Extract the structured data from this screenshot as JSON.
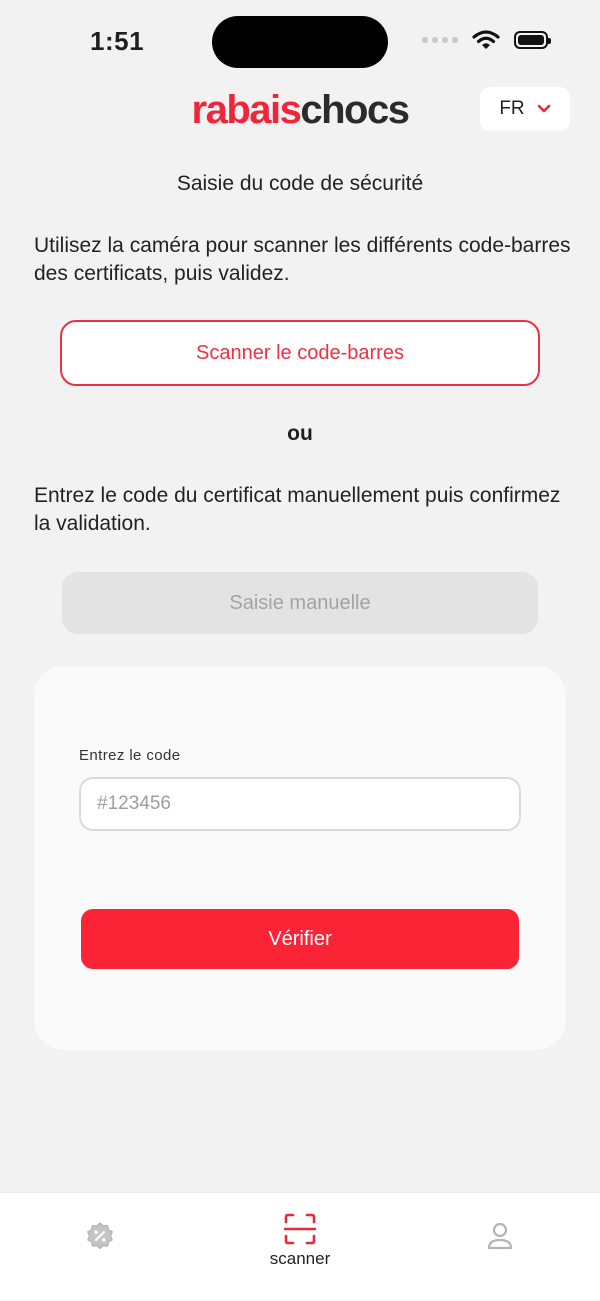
{
  "status_bar": {
    "time": "1:51"
  },
  "header": {
    "logo_part1": "rabais",
    "logo_part2": "chocs",
    "language": "FR",
    "brand_color": "#f0253a"
  },
  "content": {
    "title": "Saisie du code de sécurité",
    "scan_instructions": "Utilisez la caméra pour scanner les différents code-barres des certificats, puis validez.",
    "scan_button": "Scanner le code-barres",
    "separator": "ou",
    "manual_instructions": "Entrez le code du certificat manuellement puis confirmez la validation.",
    "manual_button": "Saisie manuelle"
  },
  "code_card": {
    "field_label": "Entrez le code",
    "field_value": "",
    "field_placeholder": "#123456",
    "verify_button": "Vérifier"
  },
  "bottom_nav": {
    "items": [
      {
        "id": "deals",
        "label": "",
        "icon": "discount-badge-icon",
        "active": false
      },
      {
        "id": "scanner",
        "label": "scanner",
        "icon": "scan-icon",
        "active": true
      },
      {
        "id": "profile",
        "label": "",
        "icon": "user-icon",
        "active": false
      }
    ],
    "active_color": "#e8283b",
    "inactive_color": "#b4b4b4"
  }
}
